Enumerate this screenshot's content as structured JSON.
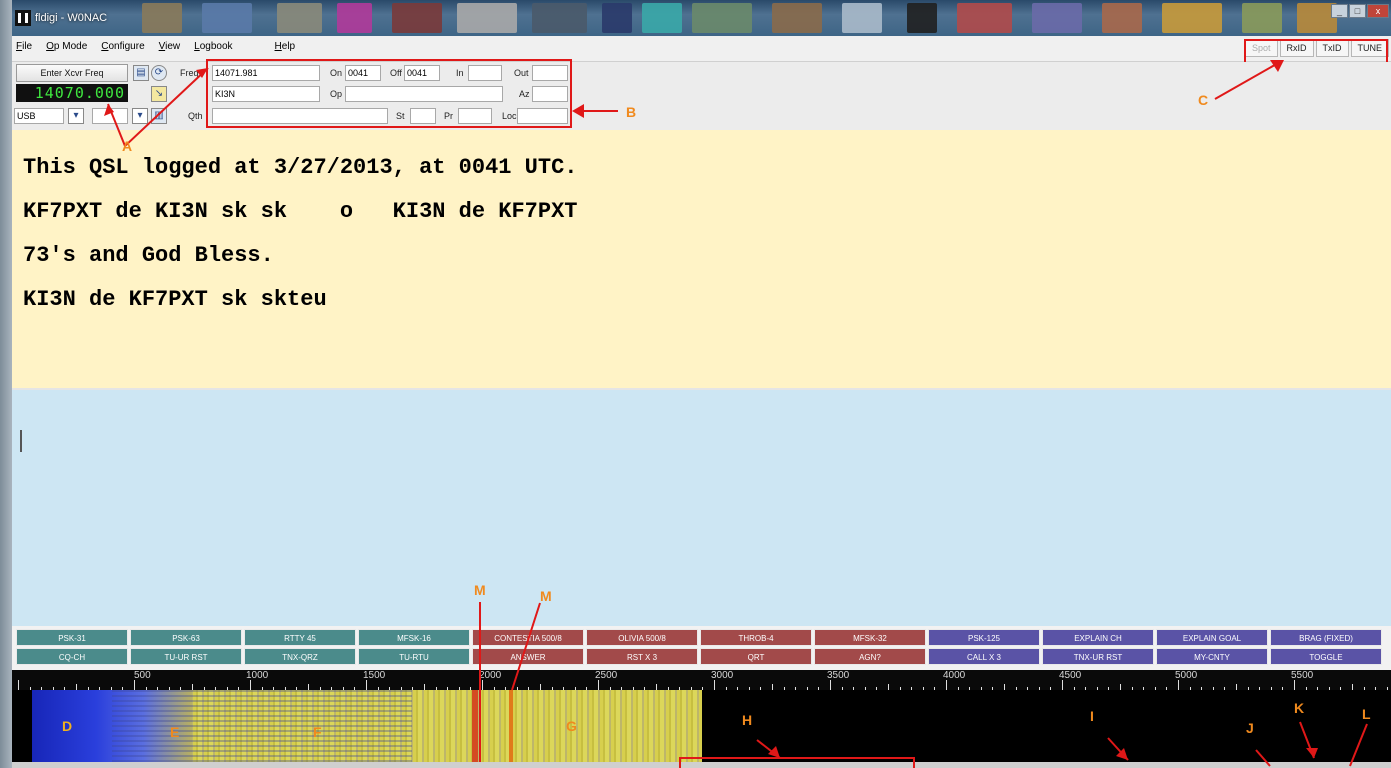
{
  "window": {
    "title": "fldigi - W0NAC"
  },
  "menu": [
    "File",
    "Op Mode",
    "Configure",
    "View",
    "Logbook",
    "Help"
  ],
  "mode_buttons": {
    "spot": "Spot",
    "rxid": "RxID",
    "txid": "TxID",
    "tune": "TUNE"
  },
  "controls": {
    "enter_xcvr_freq": "Enter Xcvr Freq",
    "frequency_display": "14070.000",
    "mode_select": "USB",
    "freq_label": "Freq",
    "freq_value": "14071.981",
    "on_label": "On",
    "on_value": "0041",
    "off_label": "Off",
    "off_value": "0041",
    "in_label": "In",
    "in_value": "",
    "out_label": "Out",
    "out_value": "",
    "call_value": "KI3N",
    "op_label": "Op",
    "op_value": "",
    "az_label": "Az",
    "az_value": "",
    "qth_label": "Qth",
    "qth_value": "",
    "st_label": "St",
    "st_value": "",
    "pr_label": "Pr",
    "pr_value": "",
    "loc_label": "Loc",
    "loc_value": ""
  },
  "rx_text": [
    "This QSL logged at 3/27/2013, at 0041 UTC.",
    "KF7PXT de KI3N sk sk    o   KI3N de KF7PXT",
    "73's and God Bless.",
    "KI3N de KF7PXT sk skteu"
  ],
  "macros": {
    "row1": [
      "PSK-31",
      "PSK-63",
      "RTTY 45",
      "MFSK-16",
      "CONTESTIA 500/8",
      "OLIVIA 500/8",
      "THROB-4",
      "MFSK-32",
      "PSK-125",
      "EXPLAIN CH",
      "EXPLAIN GOAL",
      "BRAG (FIXED)"
    ],
    "row2": [
      "CQ-CH",
      "TU-UR RST",
      "TNX-QRZ",
      "TU-RTU",
      "ANSWER",
      "RST X 3",
      "QRT",
      "AGN?",
      "CALL X 3",
      "TNX-UR RST",
      "MY-CNTY",
      "TOGGLE"
    ]
  },
  "scale_labels": [
    "500",
    "1000",
    "1500",
    "2000",
    "2500",
    "3000",
    "3500",
    "4000",
    "4500",
    "5000",
    "5500"
  ],
  "annotations": [
    "A",
    "B",
    "C",
    "D",
    "E",
    "F",
    "G",
    "H",
    "I",
    "J",
    "K",
    "L",
    "M",
    "M"
  ],
  "colors": {
    "rx_bg": "#fff3c6",
    "tx_bg": "#cde6f3",
    "annotation_red": "#e01818",
    "annotation_orange": "#f08a1e",
    "macro_teal": "#4b8b8b",
    "macro_red": "#a24a4a",
    "macro_blue": "#5a53a6",
    "freq_green": "#3fe63f"
  }
}
